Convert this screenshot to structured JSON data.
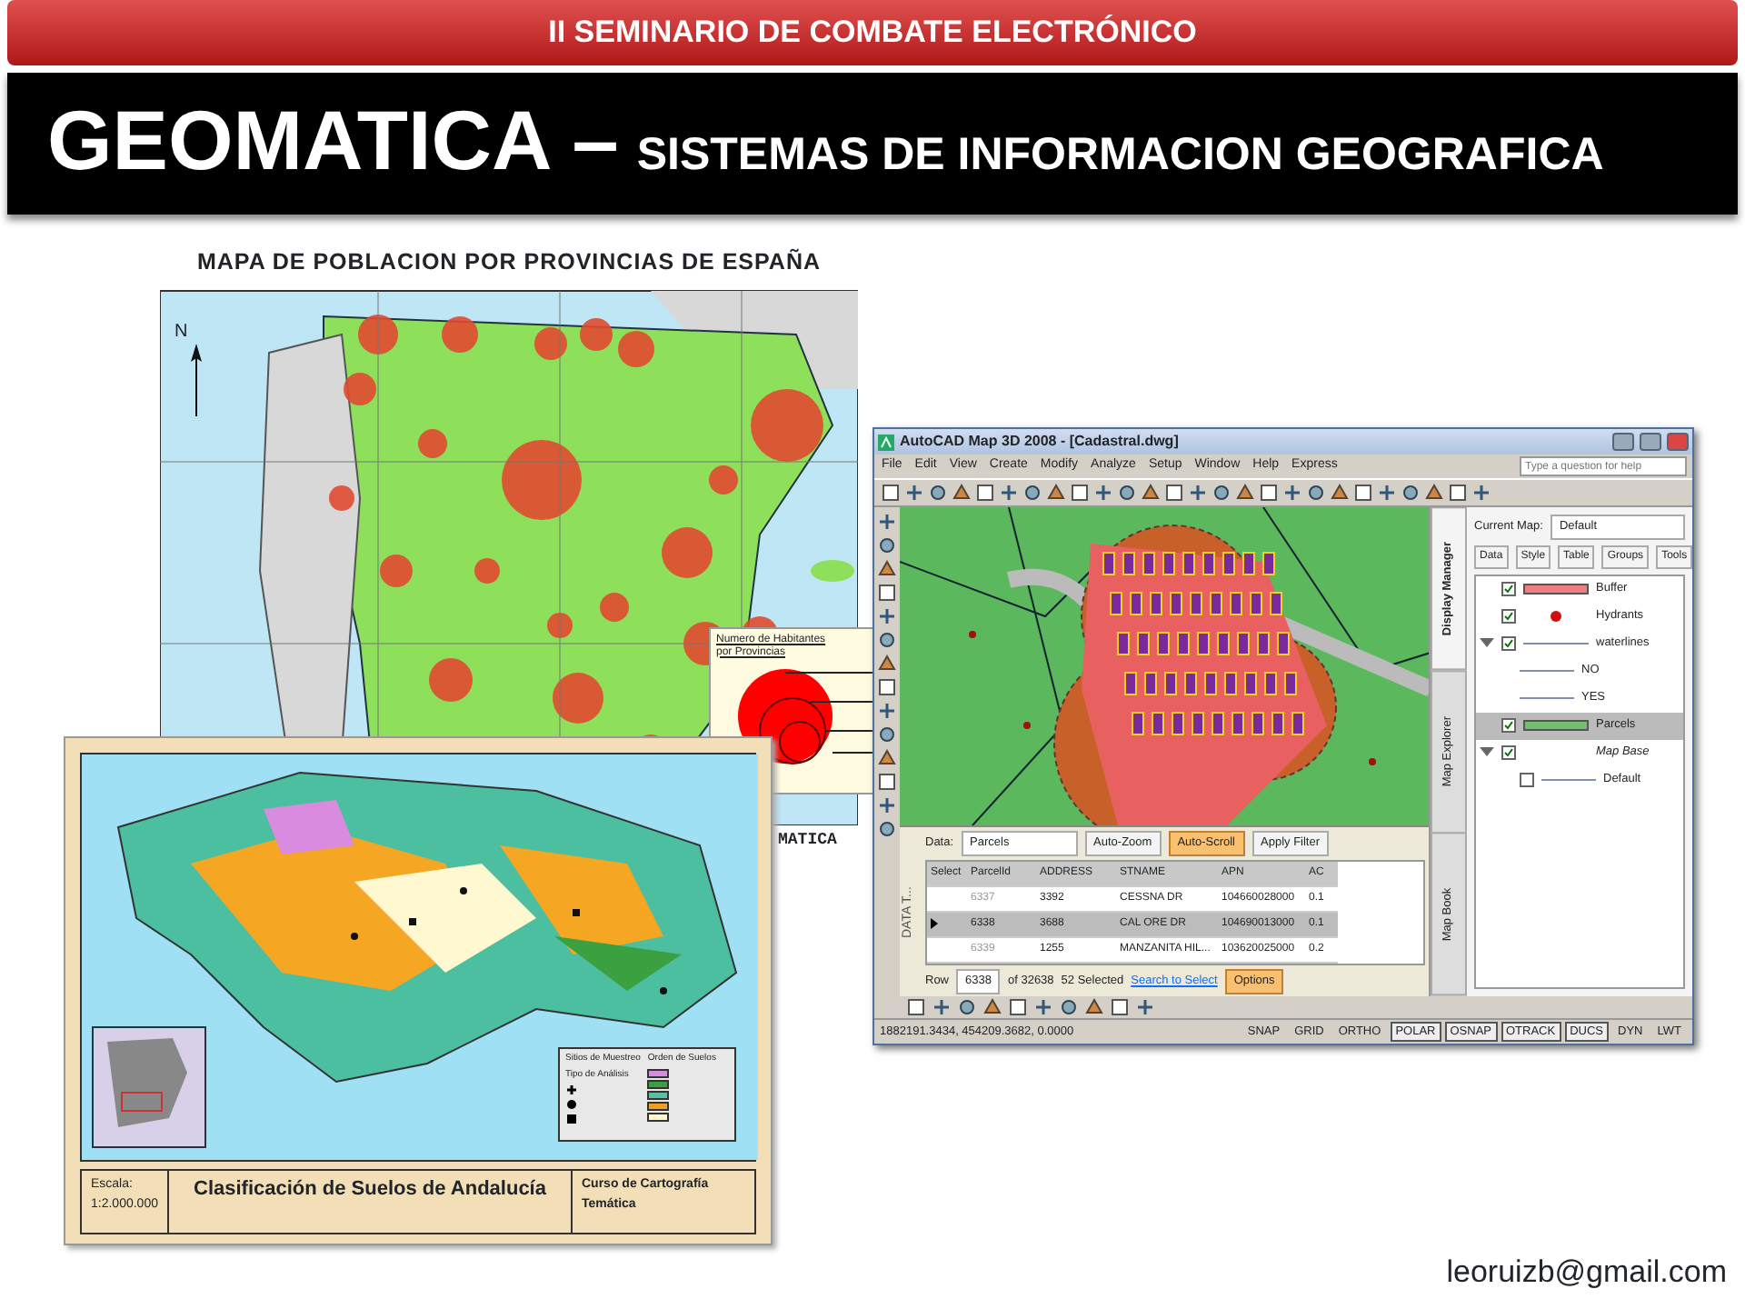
{
  "header": {
    "title": "II SEMINARIO DE COMBATE ELECTRÓNICO"
  },
  "banner": {
    "title": "GEOMATICA –",
    "subtitle": "SISTEMAS DE INFORMACION GEOGRAFICA"
  },
  "population_map": {
    "title": "MAPA DE POBLACION POR PROVINCIAS DE ESPAÑA",
    "north_label": "N",
    "legend_title": "Numero de Habitantes por Provincias",
    "caption": "MATICA"
  },
  "soils_map": {
    "samples_title": "Sitios de Muestreo",
    "analysis_title": "Tipo de Análisis",
    "samples": [
      {
        "kind": "cross"
      },
      {
        "kind": "dot"
      },
      {
        "kind": "square"
      }
    ],
    "orders_title": "Orden de Suelos",
    "orders": [
      {
        "color": "#d98be0"
      },
      {
        "color": "#3aa040"
      },
      {
        "color": "#5cc0a0"
      },
      {
        "color": "#f0a020"
      },
      {
        "color": "#fff8d0"
      }
    ],
    "scale_label": "Escala:",
    "scale": "1:2.000.000",
    "title": "Clasificación de Suelos de Andalucía",
    "course": "Curso de Cartografía Temática"
  },
  "cad_window": {
    "title": "AutoCAD Map 3D 2008 - [Cadastral.dwg]",
    "menus": [
      "File",
      "Edit",
      "View",
      "Create",
      "Modify",
      "Analyze",
      "Setup",
      "Window",
      "Help",
      "Express"
    ],
    "help_placeholder": "Type a question for help",
    "panel": {
      "tabs": [
        {
          "label": "Display Manager",
          "selected": true
        },
        {
          "label": "Map Explorer",
          "selected": false
        },
        {
          "label": "Map Book",
          "selected": false
        }
      ],
      "current_map_label": "Current Map:",
      "current_map": "Default",
      "tools": [
        "Data",
        "Style",
        "Table",
        "Groups",
        "Tools"
      ],
      "layers": [
        {
          "label": "Buffer",
          "kind": "fill",
          "color": "#f08080",
          "checked": true,
          "selected": false
        },
        {
          "label": "Hydrants",
          "kind": "point",
          "color": "#d01010",
          "checked": true,
          "selected": false
        },
        {
          "label": "waterlines",
          "kind": "line",
          "color": "#8090b0",
          "checked": true,
          "selected": false,
          "expanded": true,
          "children": [
            {
              "label": "NO"
            },
            {
              "label": "YES"
            }
          ]
        },
        {
          "label": "Parcels",
          "kind": "fill",
          "color": "#70c070",
          "checked": true,
          "selected": true
        },
        {
          "label": "Map Base",
          "kind": "group",
          "checked": true,
          "selected": false,
          "expanded": true,
          "children": [
            {
              "label": "Default",
              "checked": false
            }
          ]
        }
      ]
    },
    "data_table": {
      "vertical_label": "DATA T...",
      "data_label": "Data:",
      "source": "Parcels",
      "buttons": [
        {
          "label": "Auto-Zoom",
          "on": false
        },
        {
          "label": "Auto-Scroll",
          "on": true
        },
        {
          "label": "Apply Filter",
          "on": false
        }
      ],
      "columns": [
        "Select",
        "ParcelId",
        "ADDRESS",
        "STNAME",
        "APN",
        "AC"
      ],
      "rows": [
        {
          "cells": [
            "",
            "6337",
            "3392",
            "CESSNA DR",
            "104660028000",
            "0.1"
          ],
          "selected": false
        },
        {
          "cells": [
            "",
            "6338",
            "3688",
            "CAL ORE DR",
            "104690013000",
            "0.1"
          ],
          "selected": true
        },
        {
          "cells": [
            "",
            "6339",
            "1255",
            "MANZANITA HIL...",
            "103620025000",
            "0.2"
          ],
          "selected": false
        }
      ],
      "row_label": "Row",
      "row_value": "6338",
      "row_total": "of 32638",
      "selected_count": "52 Selected",
      "search_link": "Search to Select",
      "options": "Options"
    },
    "status_bar": {
      "coordinates": "1882191.3434, 454209.3682, 0.0000",
      "toggles": [
        {
          "label": "SNAP",
          "on": false
        },
        {
          "label": "GRID",
          "on": false
        },
        {
          "label": "ORTHO",
          "on": false
        },
        {
          "label": "POLAR",
          "on": true
        },
        {
          "label": "OSNAP",
          "on": true
        },
        {
          "label": "OTRACK",
          "on": true
        },
        {
          "label": "DUCS",
          "on": true
        },
        {
          "label": "DYN",
          "on": false
        },
        {
          "label": "LWT",
          "on": false
        }
      ]
    }
  },
  "footer": {
    "email": "leoruizb@gmail.com"
  }
}
